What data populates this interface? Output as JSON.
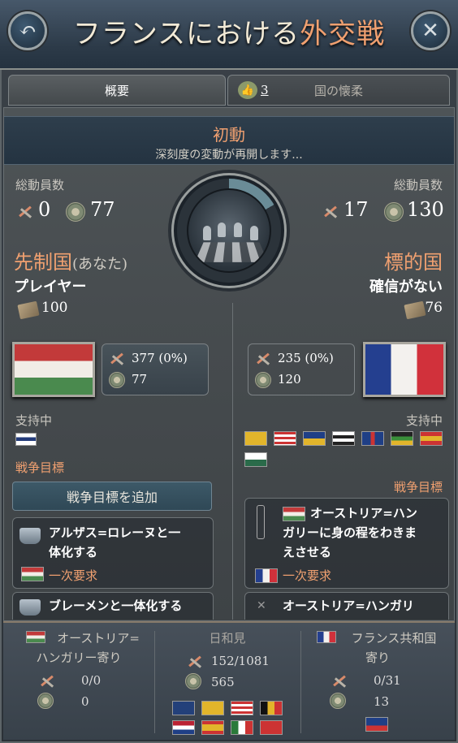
{
  "title": {
    "part1": "フランスにおける",
    "part2": "外交戦"
  },
  "tabs": [
    {
      "label": "概要"
    },
    {
      "count": "3",
      "label": "国の懐柔"
    }
  ],
  "banner": {
    "heading": "初動",
    "sub": "深刻度の変動が再開します..."
  },
  "left": {
    "mobilization_label": "総動員数",
    "rifle_value": "0",
    "manpower_value": "77",
    "role": "先制国",
    "role_note": "(あなた)",
    "player": "プレイヤー",
    "paper_value": "100",
    "stats": {
      "rifle": "377 (0%)",
      "manpower": "77"
    },
    "support_label": "支持中",
    "wargoals_label": "戦争目標",
    "add_wargoal": "戦争目標を追加",
    "goals": [
      {
        "text_1": "アルザス=ロレーヌと一",
        "text_2": "体化する",
        "req": "一次要求"
      },
      {
        "text_1": "ブレーメンと一体化する"
      }
    ]
  },
  "right": {
    "mobilization_label": "総動員数",
    "rifle_value": "17",
    "manpower_value": "130",
    "role": "標的国",
    "status": "確信がない",
    "paper_value": "76",
    "stats": {
      "rifle": "235 (0%)",
      "manpower": "120"
    },
    "support_label": "支持中",
    "wargoals_label": "戦争目標",
    "goals": [
      {
        "text_1": "オーストリア=ハン",
        "text_2": "ガリーに身の程をわきま",
        "text_3": "えさせる",
        "req": "一次要求"
      },
      {
        "text_1": "オーストリア=ハンガリ"
      }
    ]
  },
  "bottom": {
    "left": {
      "h1": "オーストリア=",
      "h2": "ハンガリー寄り",
      "rifle": "0/0",
      "manpower": "0"
    },
    "mid": {
      "h": "日和見",
      "rifle": "152/1081",
      "manpower": "565"
    },
    "right": {
      "h1": "フランス共和国",
      "h2": "寄り",
      "rifle": "0/31",
      "manpower": "13"
    }
  },
  "colors": {
    "accent": "#f0a070",
    "title_bar": "#2c3a48",
    "panel": "#474c4f"
  },
  "icons": [
    "back-icon",
    "close-icon",
    "rifle-icon",
    "manpower-icon",
    "paper-icon",
    "chess-icon",
    "ship-icon"
  ]
}
